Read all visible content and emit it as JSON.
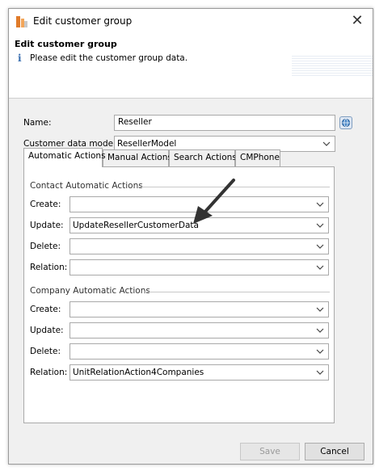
{
  "window": {
    "title": "Edit customer group"
  },
  "header": {
    "title": "Edit customer group",
    "message": "Please edit the customer group data."
  },
  "form": {
    "name_label": "Name:",
    "name_value": "Reseller",
    "model_label": "Customer data model:",
    "model_value": "ResellerModel"
  },
  "tabs": [
    {
      "label": "Automatic Actions",
      "active": true
    },
    {
      "label": "Manual Actions"
    },
    {
      "label": "Search Actions"
    },
    {
      "label": "CMPhone"
    }
  ],
  "contact_group": {
    "title": "Contact Automatic Actions",
    "rows": [
      {
        "label": "Create:",
        "value": ""
      },
      {
        "label": "Update:",
        "value": "UpdateResellerCustomerData"
      },
      {
        "label": "Delete:",
        "value": ""
      },
      {
        "label": "Relation:",
        "value": ""
      }
    ]
  },
  "company_group": {
    "title": "Company Automatic Actions",
    "rows": [
      {
        "label": "Create:",
        "value": ""
      },
      {
        "label": "Update:",
        "value": ""
      },
      {
        "label": "Delete:",
        "value": ""
      },
      {
        "label": "Relation:",
        "value": "UnitRelationAction4Companies"
      }
    ]
  },
  "buttons": {
    "save": "Save",
    "cancel": "Cancel"
  },
  "icons": {
    "app": "app-icon",
    "close": "close-icon",
    "info": "info-icon",
    "globe": "globe-icon",
    "chevron": "chevron-down-icon"
  }
}
